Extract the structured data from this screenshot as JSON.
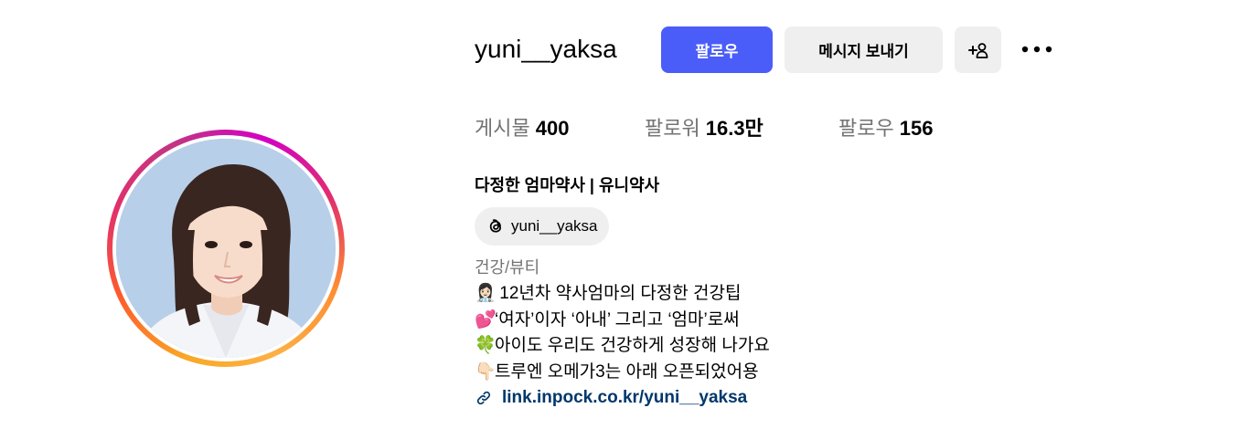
{
  "profile": {
    "username": "yuni__yaksa",
    "display_name": "다정한 엄마약사 | 유니약사",
    "threads_handle": "yuni__yaksa",
    "category": "건강/뷰티"
  },
  "actions": {
    "follow_label": "팔로우",
    "message_label": "메시지 보내기",
    "suggest_icon": "add-person-icon",
    "more_icon": "more-horizontal-icon"
  },
  "stats": {
    "posts_label": "게시물",
    "posts_value": "400",
    "followers_label": "팔로워",
    "followers_value": "16.3만",
    "following_label": "팔로우",
    "following_value": "156"
  },
  "bio": {
    "lines": [
      {
        "emoji": "👩🏻‍⚕️",
        "text": " 12년차 약사엄마의 다정한 건강팁"
      },
      {
        "emoji": "💕",
        "text": "‘여자’이자 ‘아내’ 그리고 ‘엄마’로써"
      },
      {
        "emoji": "🍀",
        "text": "아이도 우리도 건강하게 성장해 나가요"
      },
      {
        "emoji": "👇🏻",
        "text": "트루엔 오메가3는 아래 오픈되었어용"
      }
    ],
    "link": "link.inpock.co.kr/yuni__yaksa"
  },
  "colors": {
    "follow_button": "#4a5df9",
    "secondary_button": "#efefef",
    "link": "#00376b",
    "muted_text": "#737373"
  }
}
